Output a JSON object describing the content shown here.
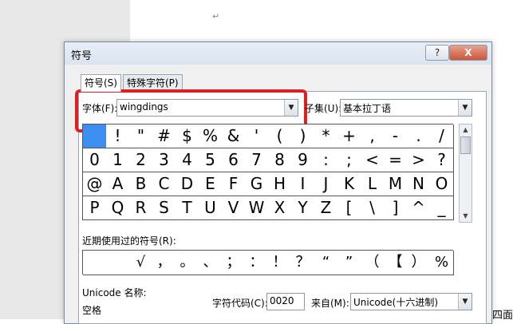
{
  "document": {
    "para_mark": "↵",
    "edge_text": "四面"
  },
  "dialog": {
    "title": "符号",
    "help_label": "?",
    "close_label": "X",
    "tabs": [
      {
        "label": "符号(S)"
      },
      {
        "label": "特殊字符(P)"
      }
    ],
    "font": {
      "label": "字体(F):",
      "value": "wingdings"
    },
    "subset": {
      "label": "子集(U):",
      "value": "基本拉丁语"
    },
    "symbol_grid": {
      "selected_index": 0,
      "rows": [
        [
          "",
          "!",
          "\"",
          "#",
          "$",
          "%",
          "&",
          "'",
          "(",
          ")",
          "*",
          "+",
          ",",
          "-",
          ".",
          "/"
        ],
        [
          "0",
          "1",
          "2",
          "3",
          "4",
          "5",
          "6",
          "7",
          "8",
          "9",
          ":",
          ";",
          "<",
          "=",
          ">",
          "?"
        ],
        [
          "@",
          "A",
          "B",
          "C",
          "D",
          "E",
          "F",
          "G",
          "H",
          "I",
          "J",
          "K",
          "L",
          "M",
          "N",
          "O"
        ],
        [
          "P",
          "Q",
          "R",
          "S",
          "T",
          "U",
          "V",
          "W",
          "X",
          "Y",
          "Z",
          "[",
          "\\",
          "]",
          "^",
          "_"
        ]
      ]
    },
    "recent": {
      "label": "近期使用过的符号(R):",
      "symbols": [
        "",
        "",
        "√",
        "，",
        "。",
        "、",
        "；",
        "：",
        "！",
        "？",
        "“",
        "”",
        "（",
        "【",
        "）",
        "%"
      ]
    },
    "unicode_name": {
      "label": "Unicode 名称:",
      "value": "空格"
    },
    "char_code": {
      "label": "字符代码(C):",
      "value": "0020"
    },
    "from": {
      "label": "来自(M):",
      "value": "Unicode(十六进制)"
    }
  }
}
